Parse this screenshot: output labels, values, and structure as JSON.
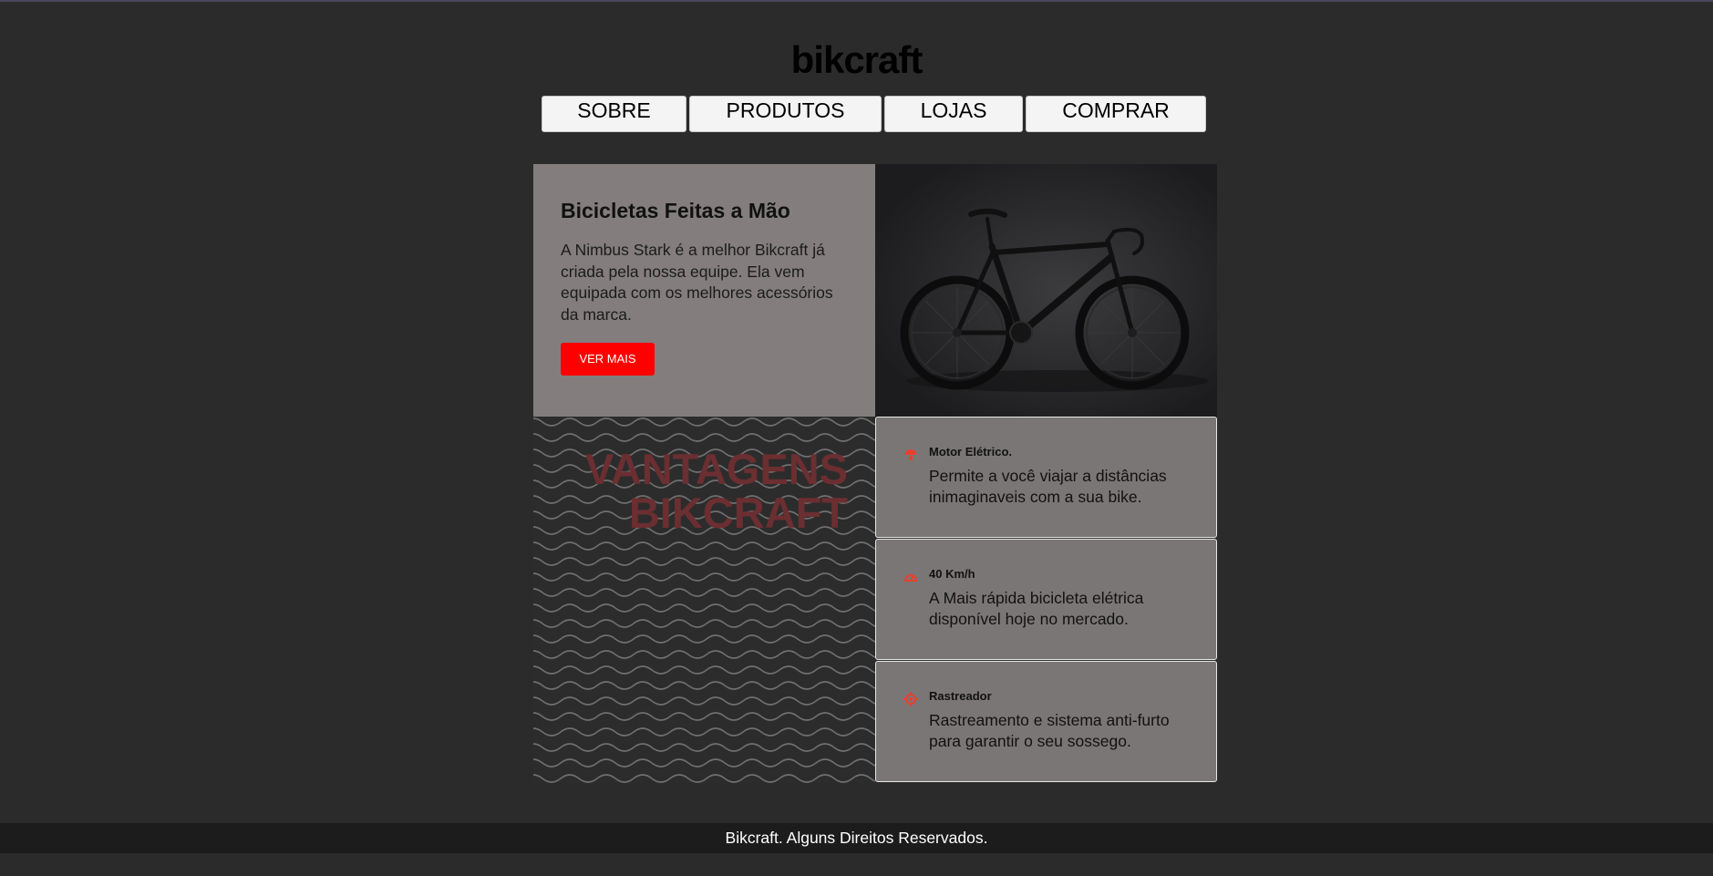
{
  "site": {
    "logo": "bikcraft"
  },
  "nav": {
    "items": [
      "SOBRE",
      "PRODUTOS",
      "LOJAS",
      "COMPRAR"
    ]
  },
  "hero": {
    "title": "Bicicletas Feitas a Mão",
    "description": "A Nimbus Stark é a melhor Bikcraft já criada pela nossa equipe. Ela vem equipada com os melhores acessórios da marca.",
    "button_label": "VER MAIS",
    "image_alt": "bicycle-photo"
  },
  "advantages": {
    "title_line1": "VANTAGENS",
    "title_line2": "BIKCRAFT",
    "items": [
      {
        "icon": "electric-motor-icon",
        "title": "Motor Elétrico.",
        "description": "Permite a você viajar a distâncias inimaginaveis com a sua bike."
      },
      {
        "icon": "speedometer-icon",
        "title": "40 Km/h",
        "description": "A Mais rápida bicicleta elétrica disponível hoje no mercado."
      },
      {
        "icon": "tracker-icon",
        "title": "Rastreador",
        "description": "Rastreamento e sistema anti-furto para garantir o seu sossego."
      }
    ]
  },
  "footer": {
    "text": "Bikcraft. Alguns Direitos Reservados."
  },
  "colors": {
    "background": "#2b2b2b",
    "accent": "#ff0000",
    "hero_panel": "#837d7d",
    "feature_panel": "#7b7676",
    "advantages_title": "#6b2e31",
    "icon": "#e8402e"
  }
}
